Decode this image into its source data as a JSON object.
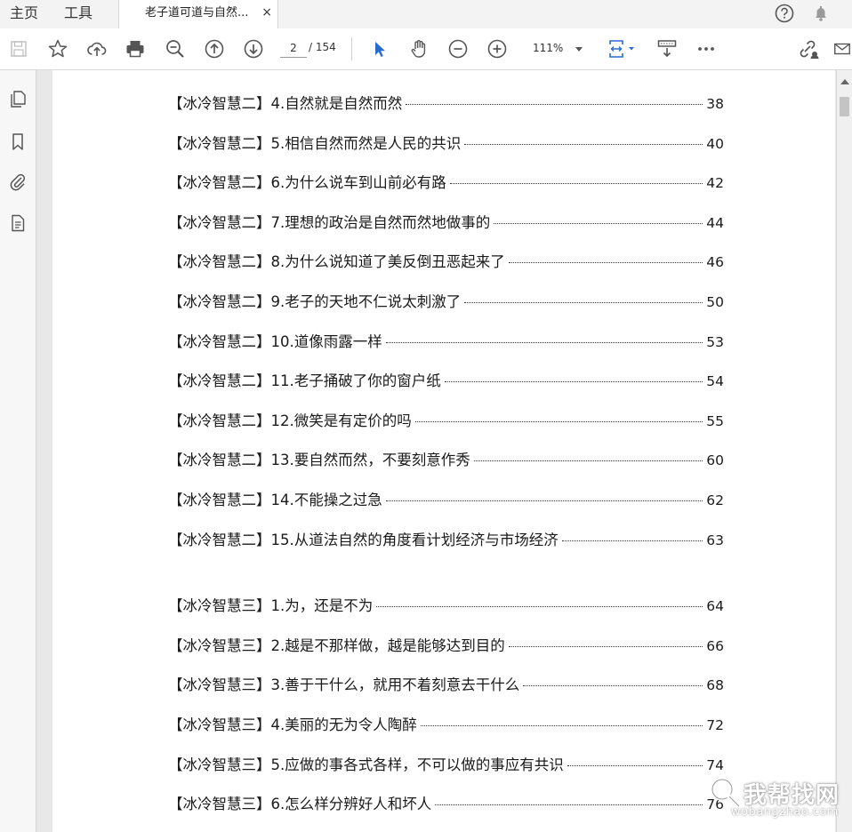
{
  "nav": {
    "home_label": "主页",
    "tools_label": "工具"
  },
  "tab": {
    "title": "老子道可道与自然...",
    "close_glyph": "×"
  },
  "toolbar": {
    "current_page": "2",
    "page_total": "/ 154",
    "zoom": "111%"
  },
  "toc": {
    "entries": [
      {
        "title": "【冰冷智慧二】4.自然就是自然而然",
        "page": "38"
      },
      {
        "title": "【冰冷智慧二】5.相信自然而然是人民的共识",
        "page": "40"
      },
      {
        "title": "【冰冷智慧二】6.为什么说车到山前必有路",
        "page": "42"
      },
      {
        "title": "【冰冷智慧二】7.理想的政治是自然而然地做事的",
        "page": "44"
      },
      {
        "title": "【冰冷智慧二】8.为什么说知道了美反倒丑恶起来了",
        "page": "46"
      },
      {
        "title": "【冰冷智慧二】9.老子的天地不仁说太刺激了",
        "page": "50"
      },
      {
        "title": "【冰冷智慧二】10.道像雨露一样",
        "page": "53"
      },
      {
        "title": "【冰冷智慧二】11.老子捅破了你的窗户纸",
        "page": "54"
      },
      {
        "title": "【冰冷智慧二】12.微笑是有定价的吗",
        "page": "55"
      },
      {
        "title": "【冰冷智慧二】13.要自然而然，不要刻意作秀",
        "page": "60"
      },
      {
        "title": "【冰冷智慧二】14.不能操之过急",
        "page": "62"
      },
      {
        "title": "【冰冷智慧二】15.从道法自然的角度看计划经济与市场经济",
        "page": "63"
      },
      {
        "title": "【冰冷智慧三】1.为，还是不为",
        "page": "64"
      },
      {
        "title": "【冰冷智慧三】2.越是不那样做，越是能够达到目的",
        "page": "66"
      },
      {
        "title": "【冰冷智慧三】3.善于干什么，就用不着刻意去干什么",
        "page": "68"
      },
      {
        "title": "【冰冷智慧三】4.美丽的无为令人陶醉",
        "page": "72"
      },
      {
        "title": "【冰冷智慧三】5.应做的事各式各样，不可以做的事应有共识",
        "page": "74"
      },
      {
        "title": "【冰冷智慧三】6.怎么样分辨好人和坏人",
        "page": "76"
      }
    ]
  },
  "watermark": {
    "text": "我帮找网",
    "url": "wobangzhao.com"
  },
  "colors": {
    "accent_blue": "#2a6bd1",
    "icon_gray": "#555555",
    "page_bg": "#e8e8e8"
  }
}
